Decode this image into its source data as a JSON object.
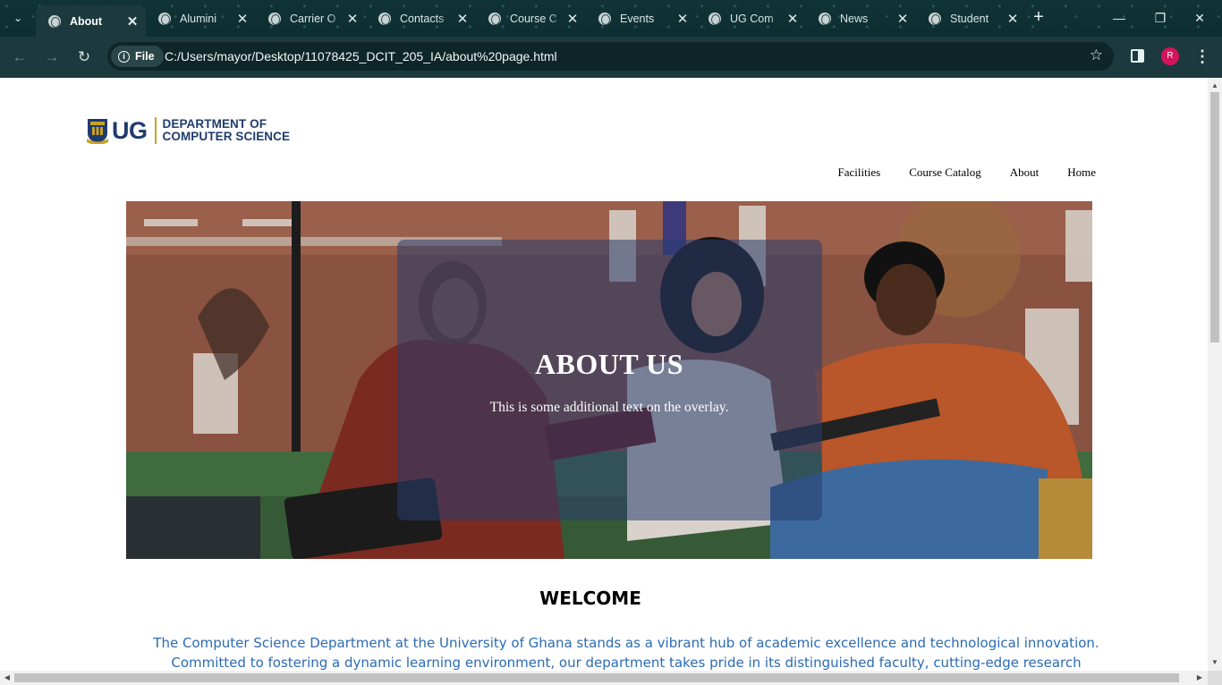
{
  "browser": {
    "tabs": [
      {
        "title": "About",
        "active": true
      },
      {
        "title": "Alumini",
        "active": false
      },
      {
        "title": "Carrier O",
        "active": false
      },
      {
        "title": "Contacts",
        "active": false
      },
      {
        "title": "Course C",
        "active": false
      },
      {
        "title": "Events",
        "active": false
      },
      {
        "title": "UG Com",
        "active": false
      },
      {
        "title": "News",
        "active": false
      },
      {
        "title": "Student",
        "active": false
      }
    ],
    "site_chip": "File",
    "url": "C:/Users/mayor/Desktop/11078425_DCIT_205_IA/about%20page.html",
    "profile_initial": "R",
    "accent_color": "#d4145a"
  },
  "site": {
    "logo": {
      "ug": "UG",
      "line1": "DEPARTMENT OF",
      "line2": "COMPUTER SCIENCE"
    },
    "nav": [
      "Facilities",
      "Course Catalog",
      "About",
      "Home"
    ],
    "hero": {
      "title": "ABOUT US",
      "subtitle": "This is some additional text on the overlay."
    },
    "welcome": {
      "heading": "WELCOME",
      "text": "The Computer Science Department at the University of Ghana stands as a vibrant hub of academic excellence and technological innovation. Committed to fostering a dynamic learning environment, our department takes pride in its distinguished faculty, cutting-edge research initiatives,"
    }
  }
}
